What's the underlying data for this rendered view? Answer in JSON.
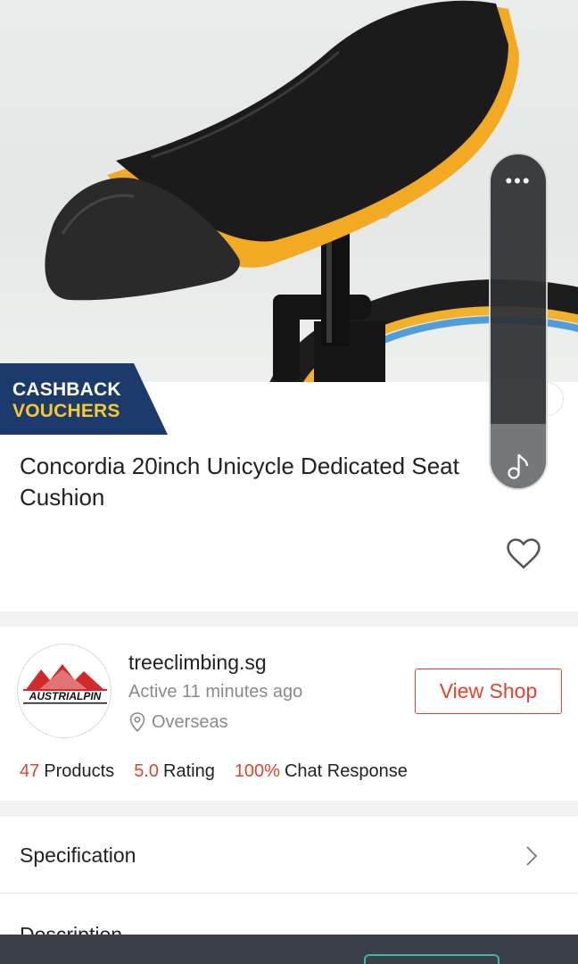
{
  "badge": {
    "line1": "CASHBACK",
    "line2": "VOUCHERS"
  },
  "product": {
    "title": "Concordia 20inch Unicycle Dedicated Seat Cushion"
  },
  "shop": {
    "name": "treeclimbing.sg",
    "active": "Active 11 minutes ago",
    "location": "Overseas",
    "logo_text": "AUSTRIALPIN",
    "view_shop_label": "View Shop"
  },
  "stats": [
    {
      "value": "47",
      "label": "Products"
    },
    {
      "value": "5.0",
      "label": "Rating"
    },
    {
      "value": "100%",
      "label": "Chat Response"
    }
  ],
  "sections": {
    "specification": "Specification",
    "description": "Description"
  },
  "widget": {
    "menu_glyph": "•••"
  },
  "colors": {
    "accent": "#e0442c",
    "badge_bg": "#1c3a6b",
    "badge_yellow": "#f7c830",
    "bottom_bar": "#3b3f4a"
  },
  "icons": [
    "heart-icon",
    "location-pin-icon",
    "chevron-right-icon",
    "music-note-icon",
    "more-dots-icon"
  ]
}
